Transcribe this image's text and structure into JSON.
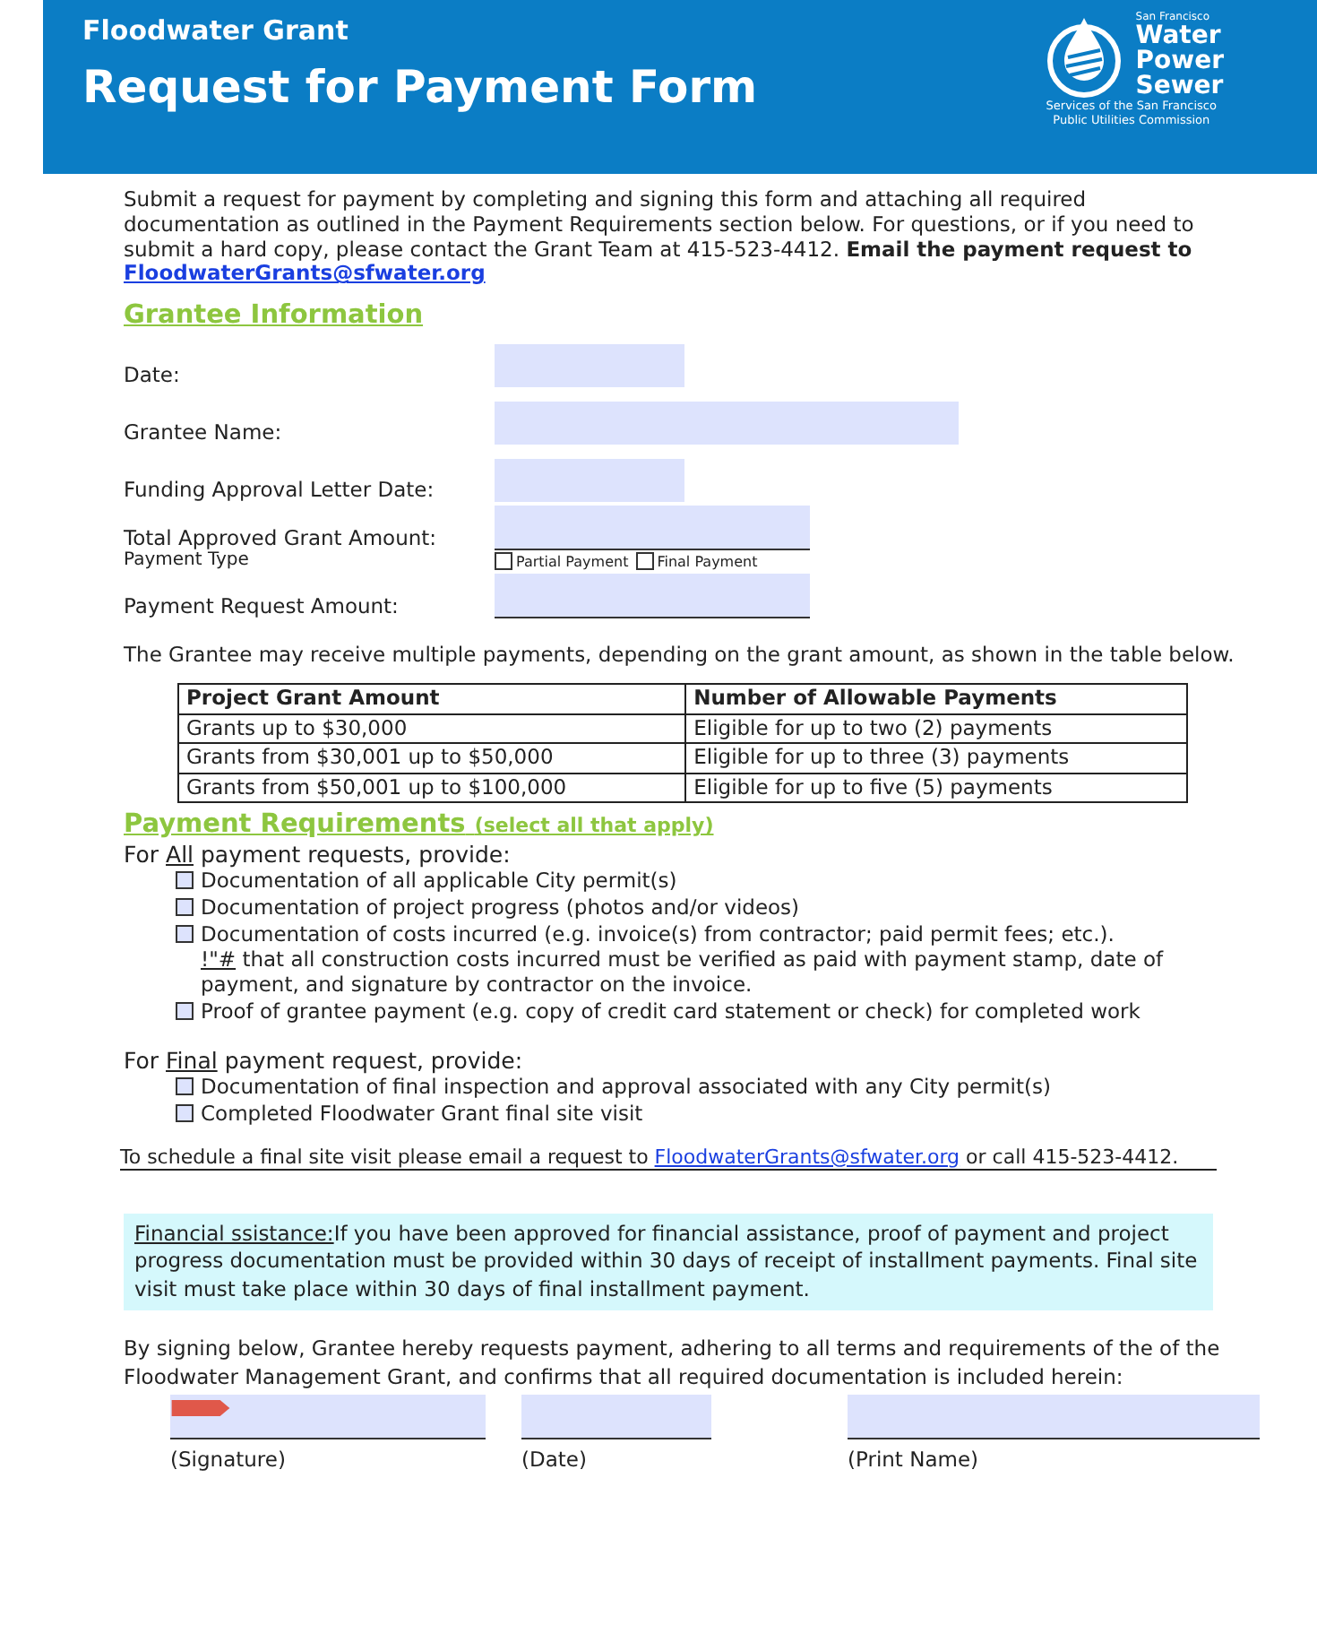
{
  "header": {
    "subtitle": "Floodwater Grant",
    "title": "Request for Payment Form",
    "logo": {
      "top": "San Francisco",
      "lines": [
        "Water",
        "Power",
        "Sewer"
      ],
      "tagline": [
        "Services of the San Francisco",
        "Public Utilities Commission"
      ]
    }
  },
  "intro": {
    "text": "Submit a request for payment by completing and signing this form and attaching all required documentation as outlined in the Payment Requirements section below. For questions, or if you need to submit a hard copy, please contact the Grant Team at 415-523-4412. **Email the payment request to**",
    "link": "FloodwaterGrants@sfwater.org"
  },
  "grantee": {
    "heading": "Grantee Information",
    "fields": [
      {
        "label": "Date:",
        "kind": "short"
      },
      {
        "label": "Grantee Name:",
        "kind": "long"
      },
      {
        "label": "Funding Approval Letter Date:",
        "kind": "short"
      },
      {
        "label": "Total Approved Grant Amount:",
        "kind": "underlined"
      }
    ],
    "payment_type": {
      "label": "Payment Type",
      "options": [
        {
          "label": "Partial Payment",
          "checked": false
        },
        {
          "label": "Final Payment",
          "checked": false
        }
      ]
    },
    "request_amount": {
      "label": "Payment Request Amount:"
    }
  },
  "table_note": "The Grantee may receive multiple payments, depending on the grant amount, as shown in the table below.",
  "table": {
    "columns": [
      "Project Grant Amount",
      "Number of Allowable Payments"
    ],
    "rows": [
      [
        "Grants up to $30,000",
        "Eligible for up to two (2) payments"
      ],
      [
        "Grants from $30,001 up to $50,000",
        "Eligible for up to three (3) payments"
      ],
      [
        "Grants from $50,001 up to $100,000",
        "Eligible for up to five (5) payments"
      ]
    ]
  },
  "requirements": {
    "heading": "Payment Requirements",
    "note": "(select all that apply)",
    "groups": [
      {
        "prefix": "For",
        "key": "All",
        "suffix": "payment requests, provide:",
        "items": [
          {
            "text": "Documentation of all applicable City permit(s)",
            "checked": false
          },
          {
            "text": "Documentation of project progress (photos and/or videos)",
            "checked": false
          },
          {
            "text": "Documentation of costs incurred (e.g. invoice(s) from contractor; paid permit fees; etc.).",
            "note_mark": "!\"#",
            "note": "that all construction costs incurred must be verified as paid with payment stamp, date of payment, and signature by contractor on the invoice.",
            "checked": false
          },
          {
            "text": "Proof of grantee payment (e.g. copy of credit card statement or check) for completed work",
            "checked": false
          }
        ]
      },
      {
        "prefix": "For",
        "key": "Final",
        "suffix": "payment request, provide:",
        "items": [
          {
            "text": "Documentation of final inspection and approval associated with any City permit(s)",
            "checked": false
          },
          {
            "text": "Completed Floodwater Grant final site visit",
            "checked": false
          }
        ]
      }
    ]
  },
  "schedule": {
    "prefix": "To schedule a final site visit please email a request to",
    "link": "FloodwaterGrants@sfwater.org",
    "suffix": "or call 415-523-4412."
  },
  "assistance": {
    "label": "Financial   ssistance:",
    "text": "If you have been approved for financial assistance,  proof of payment and project progress documentation must be provided within 30 days of receipt of installment payments. Final site visit must take place within 30 days of final installment payment."
  },
  "signing": {
    "text": "By signing below, Grantee hereby requests payment, adhering to all terms and requirements of the of the Floodwater Management Grant, and confirms that all required documentation is included herein:",
    "fields": [
      {
        "label": "(Signature)",
        "kind": "signature"
      },
      {
        "label": "(Date)",
        "kind": "date"
      },
      {
        "label": "(Print Name)",
        "kind": "name"
      }
    ]
  }
}
